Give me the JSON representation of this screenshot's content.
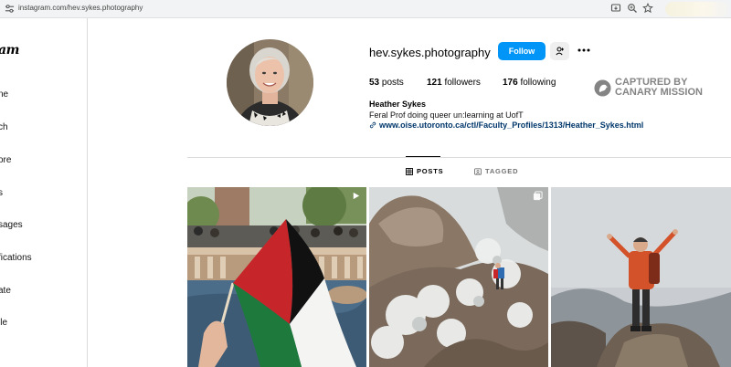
{
  "browser": {
    "url": "instagram.com/hev.sykes.photography"
  },
  "sidebar": {
    "logo": "am",
    "items": [
      {
        "label": "ne"
      },
      {
        "label": "ch"
      },
      {
        "label": "ore"
      },
      {
        "label": "s"
      },
      {
        "label": "sages"
      },
      {
        "label": "fications"
      },
      {
        "label": "ate"
      },
      {
        "label": "ile"
      }
    ]
  },
  "profile": {
    "username": "hev.sykes.photography",
    "follow_label": "Follow",
    "posts_count": "53",
    "posts_label": "posts",
    "followers_count": "121",
    "followers_label": "followers",
    "following_count": "176",
    "following_label": "following",
    "full_name": "Heather Sykes",
    "bio": "Feral Prof doing queer un:learning at UofT",
    "link": "www.oise.utoronto.ca/ctl/Faculty_Profiles/1313/Heather_Sykes.html"
  },
  "watermark": {
    "line1": "CAPTURED BY",
    "line2": "CANARY MISSION"
  },
  "tabs": [
    {
      "label": "POSTS",
      "active": true,
      "icon": "grid-icon"
    },
    {
      "label": "TAGGED",
      "active": false,
      "icon": "tag-icon"
    }
  ],
  "colors": {
    "follow_button": "#0095f6",
    "link": "#00376b"
  }
}
